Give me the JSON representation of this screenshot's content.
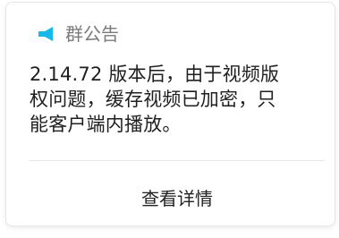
{
  "notice": {
    "title": "群公告",
    "icon": "megaphone-icon",
    "accent_color": "#17b9ea",
    "body_lines": [
      "2.14.72 版本后，由于视频版",
      "权问题，缓存视频已加密，只",
      "能客户端内播放。"
    ],
    "details_label": "查看详情"
  }
}
